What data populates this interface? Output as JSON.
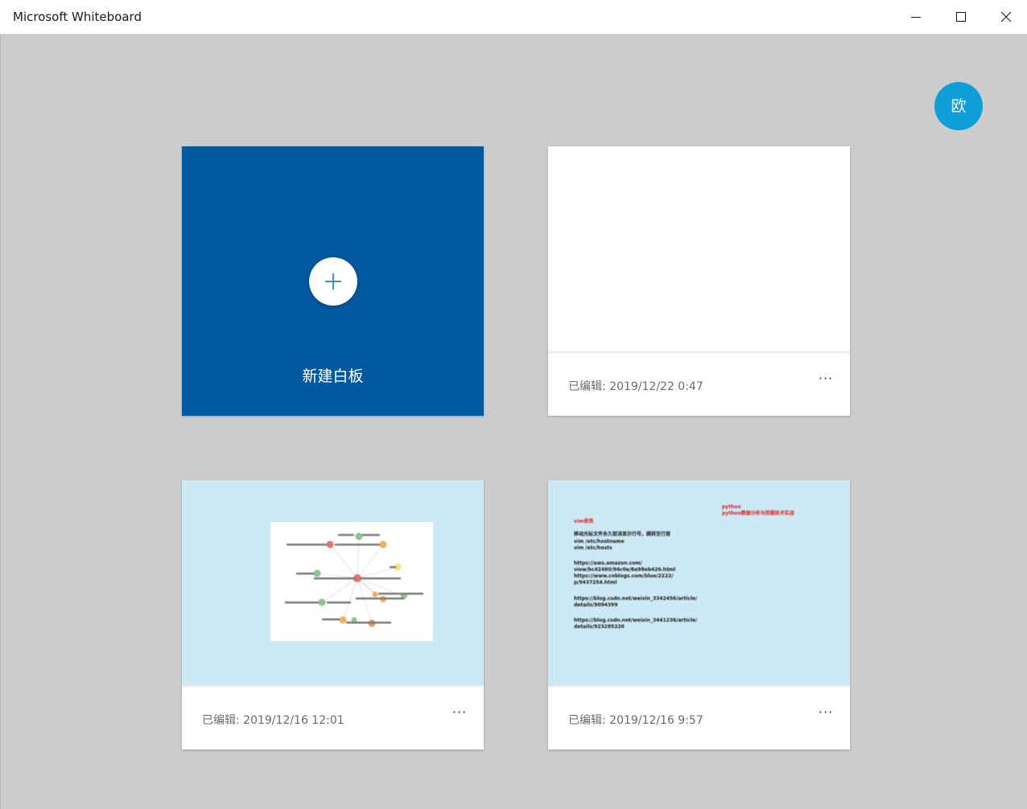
{
  "window": {
    "title": "Microsoft Whiteboard",
    "minimize_icon": "minimize-icon",
    "maximize_icon": "maximize-icon",
    "close_icon": "close-icon"
  },
  "user": {
    "avatar_text": "欧",
    "color": "#0e9ed8"
  },
  "new_board": {
    "label": "新建白板",
    "icon": "plus-icon",
    "color": "#0259a0"
  },
  "boards": [
    {
      "edited": "已编辑: 2019/12/22 0:47",
      "more": "···",
      "thumbnail": "blank"
    },
    {
      "edited": "已编辑: 2019/12/16 12:01",
      "more": "···",
      "thumbnail": "mind-map"
    },
    {
      "edited": "已编辑: 2019/12/16 9:57",
      "more": "···",
      "thumbnail": "notes"
    }
  ],
  "notes_thumbnail": {
    "red_lines": [
      "python",
      "python数据分析与挖掘技术实战",
      "vim使用"
    ],
    "lines": [
      "移动光标文件永久取消显示行号，跳转至行首",
      "vim /etc/hostname",
      "vim /etc/hosts",
      "https://aws.amazon.com/",
      "view/bc42480/94c0e/6e98eb426.html",
      "https://www.cnblogs.com/blue/2222/",
      "p/9437254.html",
      "https://blog.csdn.net/weixin_3342456/article/",
      "details/9094399",
      "https://blog.csdn.net/weixin_3441236/article/",
      "details/923285220"
    ]
  },
  "colors": {
    "background": "#cccccc",
    "thumbnail_blue": "#cde9f6",
    "text_muted": "#6b6b6b"
  }
}
